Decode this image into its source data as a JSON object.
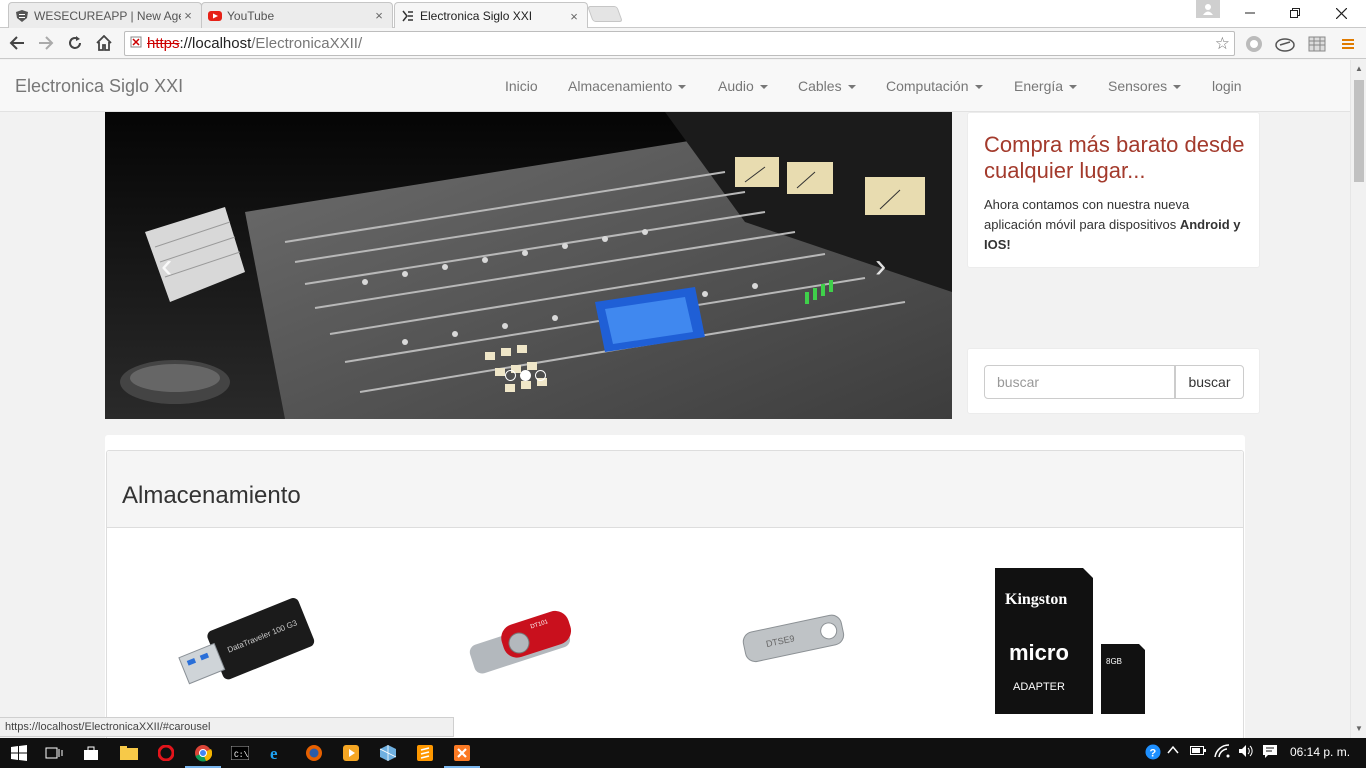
{
  "browser": {
    "tabs": [
      {
        "title": "WESECUREAPP | New Age",
        "favicon": "shield-icon",
        "close": "×"
      },
      {
        "title": "YouTube",
        "favicon": "youtube-icon",
        "close": "×"
      },
      {
        "title": "Electronica Siglo XXI",
        "favicon": "site-icon",
        "close": "×"
      }
    ],
    "address": {
      "scheme": "https",
      "host": "localhost",
      "path": "/ElectronicaXXII/"
    },
    "status_url": "https://localhost/ElectronicaXXII/#carousel"
  },
  "site": {
    "brand": "Electronica Siglo XXI",
    "nav": [
      "Inicio",
      "Almacenamiento",
      "Audio",
      "Cables",
      "Computación",
      "Energía",
      "Sensores",
      "login"
    ]
  },
  "promo": {
    "title": "Compra más barato desde cualquier lugar...",
    "text": "Ahora contamos con nuestra nueva aplicación móvil para dispositivos",
    "bold": "Android y IOS!"
  },
  "search": {
    "placeholder": "buscar",
    "button": "buscar"
  },
  "carousel": {
    "prev": "‹",
    "next": "›",
    "slides": 3,
    "active_slide": 1
  },
  "section": {
    "title": "Almacenamiento"
  },
  "products": [
    {
      "name": "usb-drive-black",
      "label": "DataTraveler 100 G3"
    },
    {
      "name": "usb-drive-red",
      "label": "DT101"
    },
    {
      "name": "usb-drive-metal",
      "label": "DTSE9"
    },
    {
      "name": "microsd-card",
      "brand": "Kingston",
      "adapter": "ADAPTER",
      "micro": "micro",
      "capacity": "8GB"
    }
  ],
  "taskbar": {
    "clock": "06:14 p. m."
  },
  "colors": {
    "accent": "#a33a2c",
    "navbar": "#f8f8f8",
    "page_bg": "#f2f2f2"
  }
}
